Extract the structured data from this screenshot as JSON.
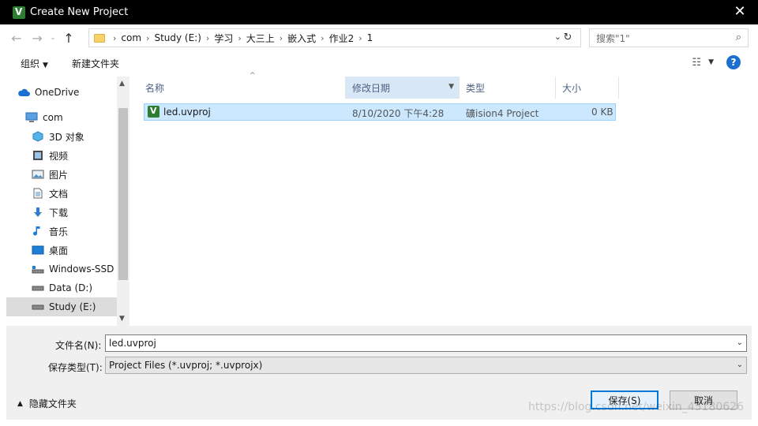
{
  "window": {
    "title": "Create New Project",
    "close_glyph": "✕"
  },
  "address": {
    "back": "←",
    "forward": "→",
    "up": "↑",
    "breadcrumbs": [
      "com",
      "Study (E:)",
      "学习",
      "大三上",
      "嵌入式",
      "作业2",
      "1"
    ],
    "search_placeholder": "搜索\"1\""
  },
  "toolbar": {
    "organize": "组织",
    "new_folder": "新建文件夹"
  },
  "nav": {
    "items": [
      {
        "label": "OneDrive",
        "icon": "cloud-icon"
      },
      {
        "label": "com",
        "icon": "computer-icon"
      },
      {
        "label": "3D 对象",
        "icon": "cube-icon"
      },
      {
        "label": "视频",
        "icon": "video-icon"
      },
      {
        "label": "图片",
        "icon": "picture-icon"
      },
      {
        "label": "文档",
        "icon": "document-icon"
      },
      {
        "label": "下载",
        "icon": "download-icon"
      },
      {
        "label": "音乐",
        "icon": "music-icon"
      },
      {
        "label": "桌面",
        "icon": "desktop-icon"
      },
      {
        "label": "Windows-SSD",
        "icon": "drive-icon"
      },
      {
        "label": "Data (D:)",
        "icon": "drive-icon"
      },
      {
        "label": "Study (E:)",
        "icon": "drive-icon"
      }
    ],
    "selected_index": 11
  },
  "files": {
    "columns": [
      "名称",
      "修改日期",
      "类型",
      "大小"
    ],
    "rows": [
      {
        "name": "led.uvproj",
        "date": "8/10/2020 下午4:28",
        "type": "礦ision4 Project",
        "size": "0 KB"
      }
    ]
  },
  "form": {
    "filename_label": "文件名(N):",
    "filename_value": "led.uvproj",
    "filetype_label": "保存类型(T):",
    "filetype_value": "Project Files (*.uvproj; *.uvprojx)",
    "hide_folders": "隐藏文件夹",
    "save": "保存(S)",
    "cancel": "取消"
  },
  "watermark": "https://blog.csdn.net/weixin_45180626",
  "colors": {
    "accent": "#0078d7",
    "selection": "#cce8ff",
    "titlebar": "#000000"
  }
}
